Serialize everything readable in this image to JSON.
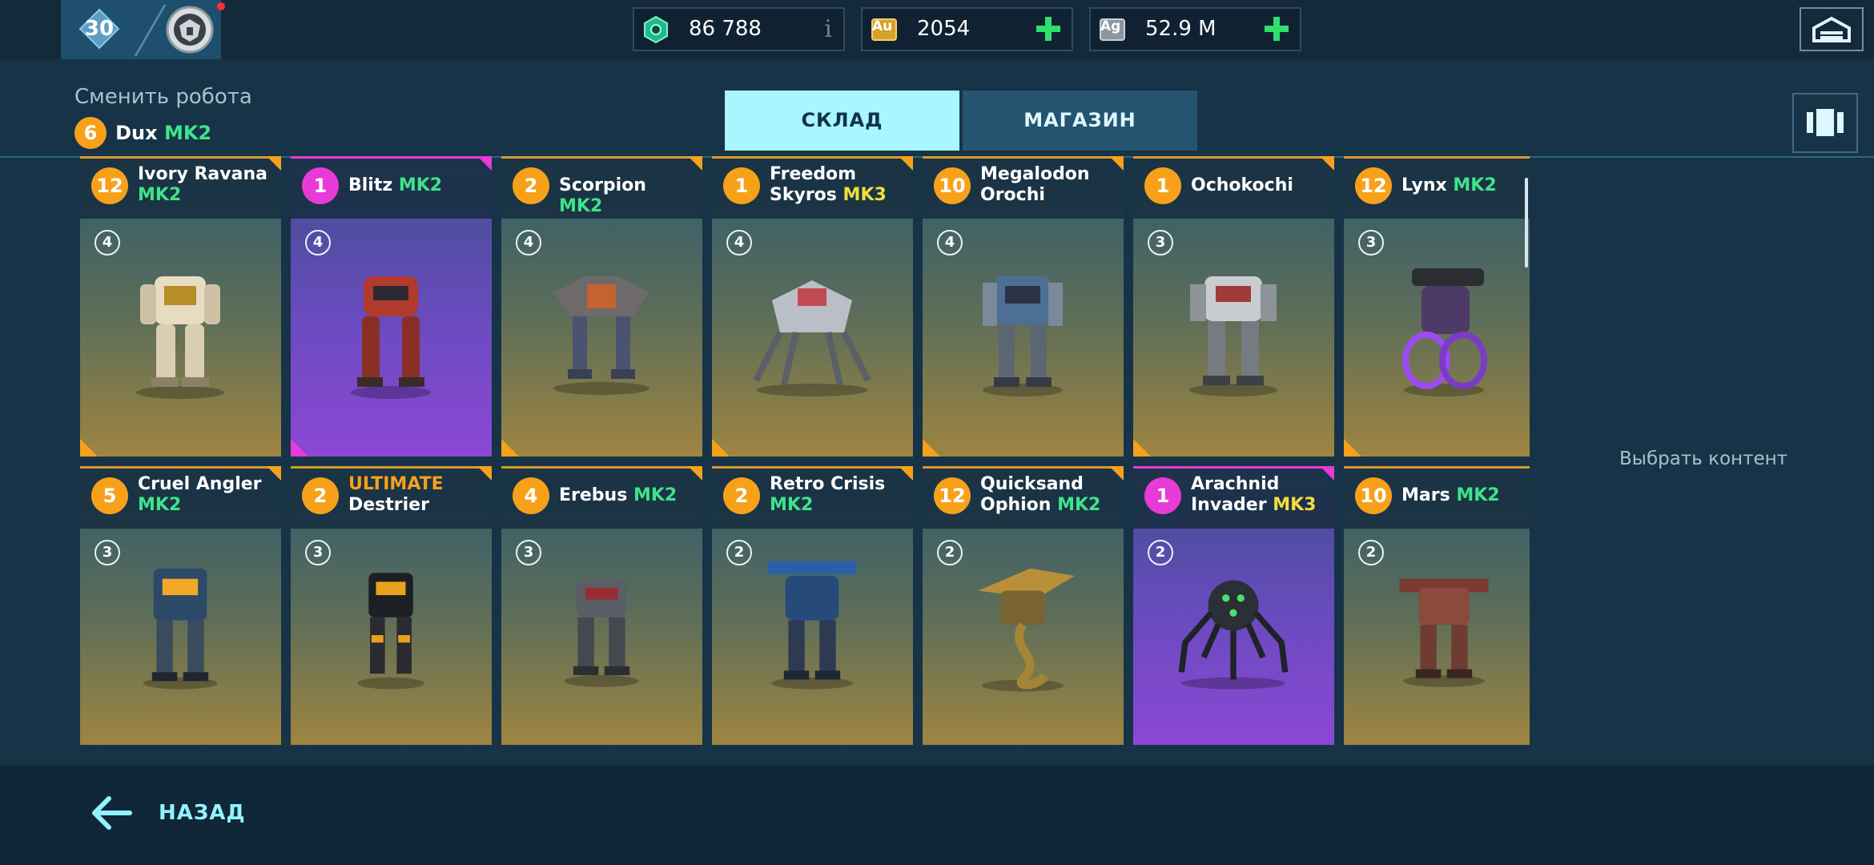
{
  "top_bar": {
    "player_level": "30",
    "currencies": [
      {
        "name": "Power Cells",
        "value": "86 788",
        "icon": "power-cell-icon",
        "suffix": "i"
      },
      {
        "name": "Au",
        "value": "2054",
        "icon": "gold-icon",
        "icon_text": "Au"
      },
      {
        "name": "Ag",
        "value": "52.9 M",
        "icon": "silver-icon",
        "icon_text": "Ag"
      }
    ]
  },
  "header": {
    "change_robot_label": "Сменить робота",
    "current_robot": {
      "level": "6",
      "name": "Dux",
      "mk": "MK2"
    }
  },
  "tabs": [
    {
      "label": "СКЛАД",
      "active": true
    },
    {
      "label": "МАГАЗИН",
      "active": false
    }
  ],
  "robots": [
    {
      "level": "12",
      "line1": "Ivory Ravana",
      "line2": "MK2",
      "slots": "4",
      "rarity": "legendary"
    },
    {
      "level": "1",
      "line1": "Blitz",
      "mk": "MK2",
      "slots": "4",
      "rarity": "epic"
    },
    {
      "level": "2",
      "line1": "Scorpion",
      "mk": "MK2",
      "slots": "4",
      "rarity": "legendary"
    },
    {
      "level": "1",
      "line1": "Freedom",
      "line2": "Skyros",
      "mk2": "MK3",
      "slots": "4",
      "rarity": "legendary"
    },
    {
      "level": "10",
      "line1": "Megalodon",
      "line2": "Orochi",
      "slots": "4",
      "rarity": "legendary"
    },
    {
      "level": "1",
      "line1": "Ochokochi",
      "slots": "3",
      "rarity": "legendary"
    },
    {
      "level": "12",
      "line1": "Lynx",
      "mk": "MK2",
      "slots": "3",
      "rarity": "legendary"
    },
    {
      "level": "5",
      "line1": "Cruel Angler",
      "line2": "MK2",
      "slots": "3",
      "rarity": "legendary"
    },
    {
      "level": "2",
      "line1": "ULTIMATE",
      "line2": "Destrier",
      "slots": "3",
      "rarity": "legendary"
    },
    {
      "level": "4",
      "line1": "Erebus",
      "mk": "MK2",
      "slots": "3",
      "rarity": "legendary"
    },
    {
      "level": "2",
      "line1": "Retro Crisis",
      "line2": "MK2",
      "slots": "2",
      "rarity": "legendary"
    },
    {
      "level": "12",
      "line1": "Quicksand",
      "line2": "Ophion",
      "mk2": "MK2",
      "slots": "2",
      "rarity": "legendary"
    },
    {
      "level": "1",
      "line1": "Arachnid",
      "line2": "Invader",
      "mk2": "MK3",
      "slots": "2",
      "rarity": "epic"
    },
    {
      "level": "10",
      "line1": "Mars",
      "mk": "MK2",
      "slots": "2",
      "rarity": "legendary"
    }
  ],
  "side": {
    "select_content_label": "Выбрать контент"
  },
  "bottom": {
    "back_label": "НАЗАД"
  },
  "colors": {
    "accent": "#a8f6ff",
    "legendary": "#f7a11b",
    "epic": "#e83ad6",
    "mk2": "#3ee48a",
    "mk3": "#f2df3c"
  }
}
